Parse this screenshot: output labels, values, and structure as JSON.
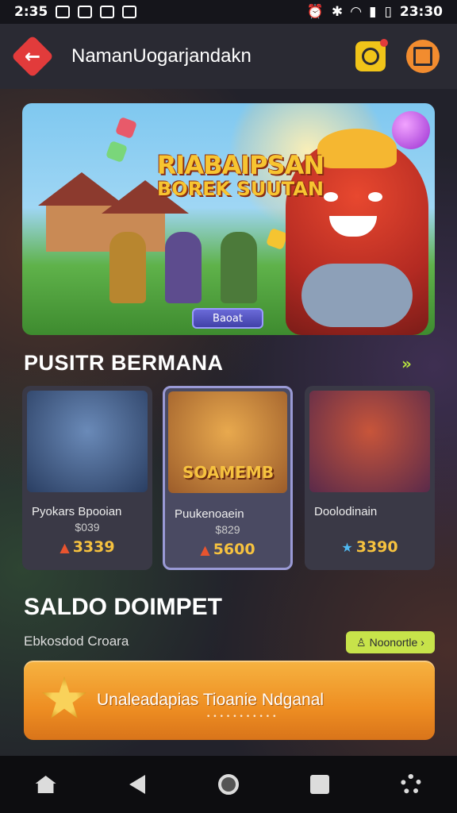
{
  "status_bar": {
    "time_left": "2:35",
    "time_right": "23:30"
  },
  "header": {
    "title": "NamanUogarjandakn"
  },
  "banner": {
    "logo_line1": "RIABAIPSAN",
    "logo_line2": "BOREK SUUTAN",
    "button_label": "Baoat"
  },
  "section": {
    "title": "PUSITR BERMANA",
    "more": "»"
  },
  "cards": [
    {
      "name": "Pyokars Bpooian",
      "sub": "$039",
      "price": "3339",
      "icon": "fire-icon",
      "label": ""
    },
    {
      "name": "Puukenoaein",
      "sub": "$829",
      "price": "5600",
      "icon": "fire-icon",
      "label": "SOAMEMB"
    },
    {
      "name": "Doolodinain",
      "sub": "",
      "price": "3390",
      "icon": "star-icon",
      "label": ""
    }
  ],
  "wallet": {
    "title": "SALDO DOIMPET",
    "subtitle": "Ebkosdod Croara",
    "chip_label": "Noonortle",
    "bar_text": "Unaleadapias Tioanie Ndganal",
    "bar_dots": "•••••••••••"
  },
  "colors": {
    "accent_red": "#e23b3b",
    "accent_yellow": "#f0c419",
    "accent_orange": "#f28c2f",
    "chip_green": "#c7e34a"
  }
}
